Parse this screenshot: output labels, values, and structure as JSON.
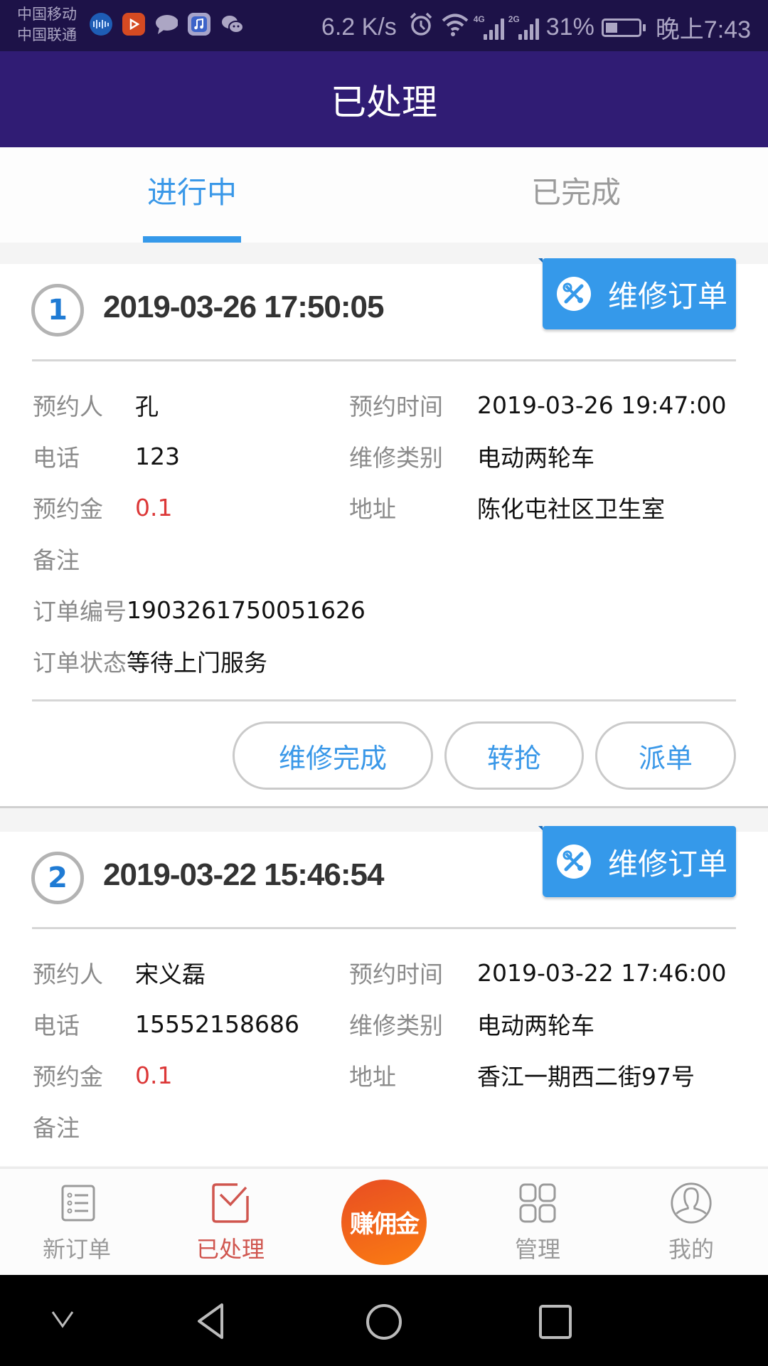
{
  "status_bar": {
    "carrier_1": "中国移动",
    "carrier_2": "中国联通",
    "app_icons": [
      "music-visualizer-icon",
      "video-play-icon",
      "message-bubble-icon",
      "music-note-icon",
      "wechat-icon"
    ],
    "net_speed": "6.2 K/s",
    "network_1": "4G",
    "network_2": "2G",
    "battery_percent": "31%",
    "battery_level": 0.31,
    "time": "晚上7:43"
  },
  "header": {
    "title": "已处理"
  },
  "tabs": [
    {
      "label": "进行中",
      "active": true
    },
    {
      "label": "已完成",
      "active": false
    }
  ],
  "labels": {
    "customer": "预约人",
    "phone": "电话",
    "deposit": "预约金",
    "note": "备注",
    "order_no": "订单编号",
    "order_status": "订单状态",
    "appt_time": "预约时间",
    "repair_type": "维修类别",
    "address": "地址"
  },
  "orders": [
    {
      "index": "1",
      "created": "2019-03-26 17:50:05",
      "badge": "维修订单",
      "customer": "孔",
      "phone": "123",
      "deposit": "0.1",
      "note": "",
      "order_no": "1903261750051626",
      "order_status": "等待上门服务",
      "appt_time": "2019-03-26 19:47:00",
      "repair_type": "电动两轮车",
      "address": "陈化屯社区卫生室",
      "actions": [
        "维修完成",
        "转抢",
        "派单"
      ]
    },
    {
      "index": "2",
      "created": "2019-03-22 15:46:54",
      "badge": "维修订单",
      "customer": "宋义磊",
      "phone": "15552158686",
      "deposit": "0.1",
      "note": "",
      "appt_time": "2019-03-22 17:46:00",
      "repair_type": "电动两轮车",
      "address": "香江一期西二街97号"
    }
  ],
  "bottom_nav": {
    "items": [
      {
        "label": "新订单",
        "icon": "list-icon"
      },
      {
        "label": "已处理",
        "icon": "mail-check-icon",
        "active": true
      },
      {
        "label": "赚佣金",
        "icon": "commission-fab"
      },
      {
        "label": "管理",
        "icon": "grid-icon"
      },
      {
        "label": "我的",
        "icon": "user-icon"
      }
    ]
  },
  "colors": {
    "header": "#301c74",
    "status_bar": "#1d1248",
    "accent_blue": "#3599ea",
    "price_red": "#dc3838",
    "nav_active": "#d0564f",
    "fab_orange": "#f06a1a"
  }
}
